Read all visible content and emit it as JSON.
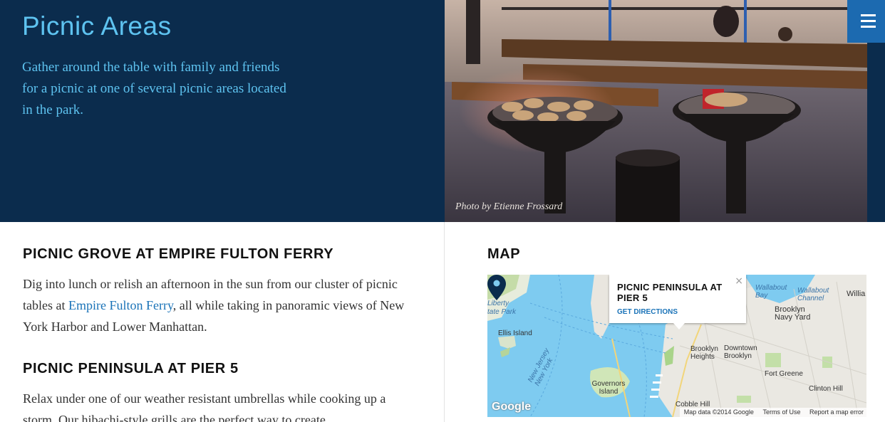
{
  "hero": {
    "title": "Picnic Areas",
    "description": "Gather around the table with family and friends for a picnic at one of several picnic areas located in the park.",
    "photo_credit": "Photo by Etienne Frossard",
    "background_color": "#0b2c4d",
    "accent_color": "#5ec3f0"
  },
  "menu": {
    "icon": "hamburger-menu-icon",
    "color": "#1c6ab0"
  },
  "sections": {
    "grove": {
      "heading": "PICNIC GROVE AT EMPIRE FULTON FERRY",
      "text_before": "Dig into lunch or relish an afternoon in the sun from our cluster of picnic tables at ",
      "link": "Empire Fulton Ferry",
      "text_after": ", all while taking in panoramic views of New York Harbor and Lower Manhattan."
    },
    "peninsula": {
      "heading": "PICNIC PENINSULA AT PIER 5",
      "text": "Relax under one of our weather resistant umbrellas while cooking up a storm. Our hibachi-style grills are the perfect way to create"
    }
  },
  "map": {
    "heading": "MAP",
    "popup": {
      "title": "PICNIC PENINSULA AT PIER 5",
      "directions": "GET DIRECTIONS",
      "close": "×"
    },
    "labels": {
      "liberty": "Liberty",
      "state_park": "tate Park",
      "ellis": "Ellis Island",
      "wallabout_bay": "Wallabout Bay",
      "wallabout_channel": "Wallabout Channel",
      "williamsburg": "Willia",
      "brooklyn_navy_yard": "Brooklyn Navy Yard",
      "brooklyn_heights": "Brooklyn Heights",
      "downtown_brooklyn": "Downtown Brooklyn",
      "fort_greene": "Fort Greene",
      "governors_island": "Governors Island",
      "new_jersey_ny": "New Jersey New York",
      "clinton_hill": "Clinton Hill",
      "cobble_hill": "Cobble Hill"
    },
    "logo": "Google",
    "footer": {
      "data": "Map data ©2014 Google",
      "terms": "Terms of Use",
      "report": "Report a map error"
    }
  }
}
